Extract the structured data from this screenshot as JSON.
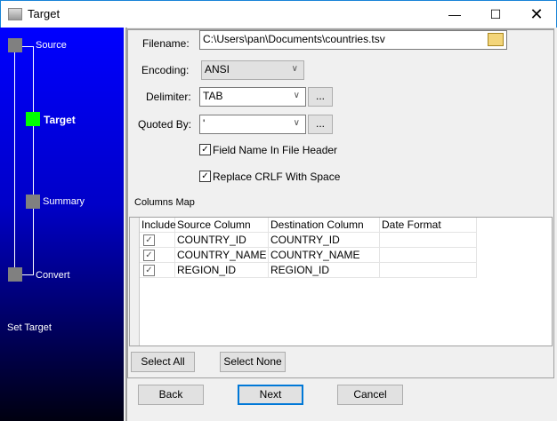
{
  "window": {
    "title": "Target",
    "controls": [
      "minimize",
      "maximize",
      "close"
    ]
  },
  "sidebar": {
    "steps": [
      {
        "label": "Source",
        "state": "done",
        "color": "#808080"
      },
      {
        "label": "Target",
        "state": "current",
        "color": "#00ff00"
      },
      {
        "label": "Summary",
        "state": "pending",
        "color": "#808080"
      },
      {
        "label": "Convert",
        "state": "pending",
        "color": "#808080"
      }
    ],
    "caption": "Set Target"
  },
  "form": {
    "filename_label": "Filename:",
    "filename_value": "C:\\Users\\pan\\Documents\\countries.tsv",
    "encoding_label": "Encoding:",
    "encoding_value": "ANSI",
    "delimiter_label": "Delimiter:",
    "delimiter_value": "TAB",
    "quoted_label": "Quoted By:",
    "quoted_value": "'",
    "ellipsis": "...",
    "field_name_header": {
      "label": "Field Name In File Header",
      "checked": true
    },
    "replace_crlf": {
      "label": "Replace CRLF With Space",
      "checked": true
    }
  },
  "columns_map": {
    "title": "Columns Map",
    "headers": [
      "Include",
      "Source Column",
      "Destination Column",
      "Date Format"
    ],
    "rows": [
      {
        "include": true,
        "source": "COUNTRY_ID",
        "dest": "COUNTRY_ID",
        "date": ""
      },
      {
        "include": true,
        "source": "COUNTRY_NAME",
        "dest": "COUNTRY_NAME",
        "date": ""
      },
      {
        "include": true,
        "source": "REGION_ID",
        "dest": "REGION_ID",
        "date": ""
      }
    ],
    "select_all": "Select All",
    "select_none": "Select None"
  },
  "footer": {
    "back": "Back",
    "next": "Next",
    "cancel": "Cancel"
  }
}
